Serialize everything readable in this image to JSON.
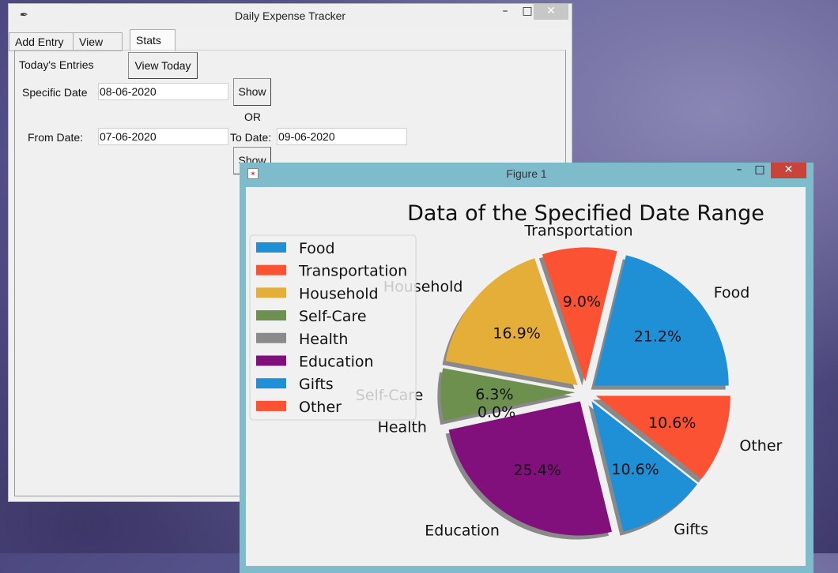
{
  "tracker": {
    "title": "Daily Expense Tracker",
    "tabs": [
      "Add Entry",
      "View",
      "Stats"
    ],
    "todays_entries_label": "Today's Entries",
    "view_today_button": "View Today",
    "specific_date_label": "Specific Date",
    "specific_date_value": "08-06-2020",
    "show_button": "Show",
    "or_label": "OR",
    "from_date_label": "From Date:",
    "from_date_value": "07-06-2020",
    "to_date_label": "To Date:",
    "to_date_value": "09-06-2020",
    "show_range_button": "Show"
  },
  "figure": {
    "window_title": "Figure 1"
  },
  "colors": {
    "food": "#1f8fd6",
    "transportation": "#fa5232",
    "household": "#e5ae38",
    "self_care": "#6d904f",
    "health": "#8b8b8b",
    "education": "#810f7c",
    "gifts": "#1f8fd6",
    "other": "#fa5232",
    "figure_titlebar": "#7ebccb",
    "close_red": "#c8433a"
  },
  "chart_data": {
    "type": "pie",
    "title": "Data of the Specified Date Range",
    "categories": [
      "Food",
      "Transportation",
      "Household",
      "Self-Care",
      "Health",
      "Education",
      "Gifts",
      "Other"
    ],
    "values": [
      21.2,
      9.0,
      16.9,
      6.3,
      0.0,
      25.4,
      10.6,
      10.6
    ],
    "value_labels": [
      "21.2%",
      "9.0%",
      "16.9%",
      "6.3%",
      "0.0%",
      "25.4%",
      "10.6%",
      "10.6%"
    ],
    "colors": [
      "#1f8fd6",
      "#fa5232",
      "#e5ae38",
      "#6d904f",
      "#8b8b8b",
      "#810f7c",
      "#1f8fd6",
      "#fa5232"
    ],
    "legend": [
      "Food",
      "Transportation",
      "Household",
      "Self-Care",
      "Health",
      "Education",
      "Gifts",
      "Other"
    ],
    "legend_position": "left",
    "exploded": true,
    "shadow": true
  }
}
